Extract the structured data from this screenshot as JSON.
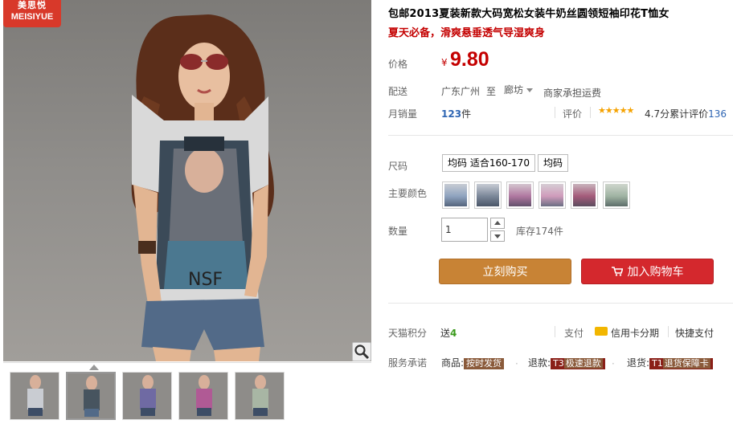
{
  "brand": {
    "cn": "美思悦",
    "en": "MEISIYUE"
  },
  "product": {
    "title": "包邮2013夏装新款大码宽松女装牛奶丝圆领短袖印花T恤女",
    "subtitle": "夏天必备，滑爽悬垂透气导湿爽身"
  },
  "price": {
    "label": "价格",
    "currency": "¥",
    "value": "9.80"
  },
  "shipping": {
    "label": "配送",
    "from": "广东广州",
    "to_word": "至",
    "dest": "廊坊",
    "note": "商家承担运费"
  },
  "sales": {
    "label": "月销量",
    "count": "123",
    "unit": "件"
  },
  "review": {
    "label": "评价",
    "stars": "★★★★★",
    "score": "4.7分",
    "total_label": "累计评价",
    "total": "136"
  },
  "size": {
    "label": "尺码",
    "options": [
      "均码 适合160-170",
      "均码"
    ]
  },
  "color": {
    "label": "主要颜色",
    "swatches": [
      "#9fb3c9",
      "#8d9bb0",
      "#b987a8",
      "#c9a7bf",
      "#a56b83",
      "#a7b8a8"
    ]
  },
  "quantity": {
    "label": "数量",
    "value": "1",
    "stock": "库存174件"
  },
  "buttons": {
    "buy": "立刻购买",
    "cart": "加入购物车"
  },
  "points": {
    "label": "天猫积分",
    "text": "送",
    "value": "4"
  },
  "payment": {
    "label": "支付",
    "card": "信用卡分期",
    "quick": "快捷支付"
  },
  "service": {
    "label": "服务承诺",
    "items": [
      {
        "prefix": "商品:",
        "tag": "按时发货"
      },
      {
        "prefix": "退款:",
        "code": "T3",
        "tag": "极速退款"
      },
      {
        "prefix": "退货:",
        "code": "T1",
        "tag": "退货保障卡"
      }
    ]
  },
  "colors": {
    "price_red": "#c40000",
    "buy_btn": "#c88335",
    "cart_btn": "#d4282d",
    "link_blue": "#2e65b3"
  }
}
